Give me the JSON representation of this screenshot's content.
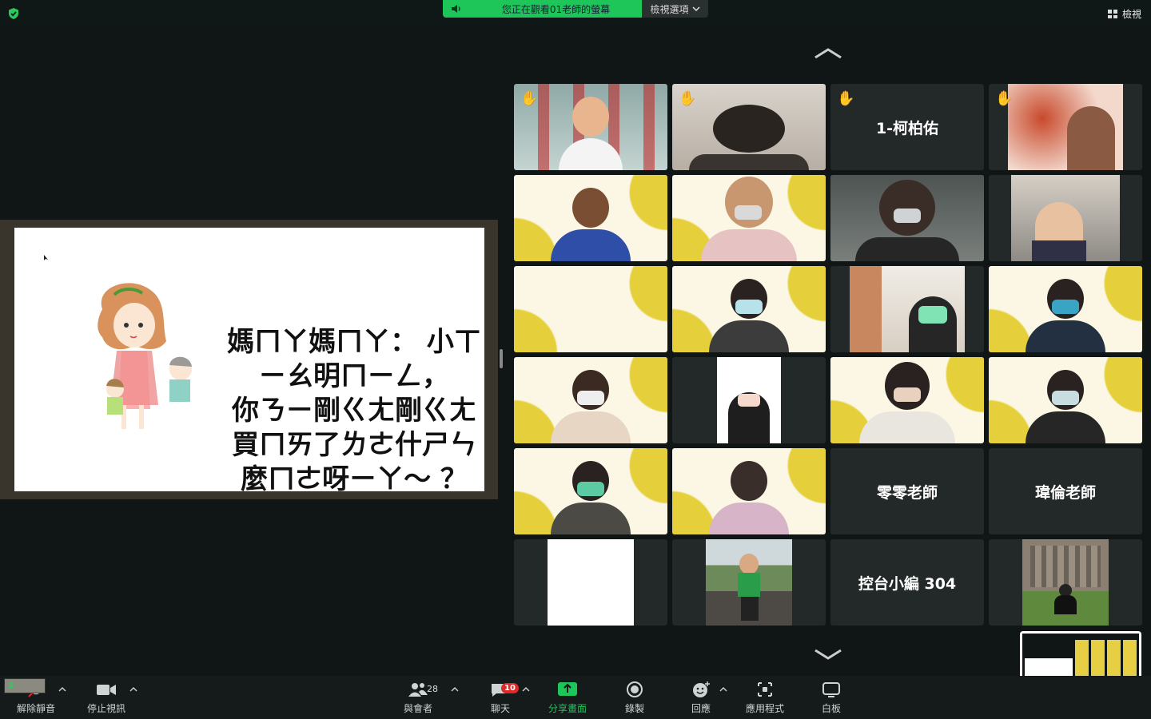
{
  "top": {
    "viewing_notice": "您正在觀看01老師的螢幕",
    "view_options": "檢視選項",
    "view_button": "檢視"
  },
  "slide": {
    "line1": "媽ㄇㄚ媽ㄇㄚ： 小ㄒㄧㄠ明ㄇㄧㄥ，",
    "line2": "你ㄋㄧ剛ㄍㄤ剛ㄍㄤ買ㄇㄞ了ㄌㄜ什ㄕㄣ",
    "line3": "麼ㄇㄜ呀ㄧㄚ～ ？"
  },
  "participants": [
    {
      "name": "",
      "hand": true
    },
    {
      "name": "",
      "hand": true
    },
    {
      "name": "1-柯柏佑",
      "hand": true
    },
    {
      "name": "",
      "hand": true
    },
    {
      "name": ""
    },
    {
      "name": ""
    },
    {
      "name": "",
      "active": true
    },
    {
      "name": ""
    },
    {
      "name": ""
    },
    {
      "name": ""
    },
    {
      "name": ""
    },
    {
      "name": ""
    },
    {
      "name": ""
    },
    {
      "name": ""
    },
    {
      "name": ""
    },
    {
      "name": ""
    },
    {
      "name": ""
    },
    {
      "name": ""
    },
    {
      "name": "零零老師"
    },
    {
      "name": "瑋倫老師"
    },
    {
      "name": ""
    },
    {
      "name": ""
    },
    {
      "name": "控台小編 304"
    },
    {
      "name": ""
    }
  ],
  "toolbar": {
    "unmute": "解除靜音",
    "stop_video": "停止視訊",
    "participants": "與會者",
    "participants_count": "28",
    "chat": "聊天",
    "chat_badge": "10",
    "share_screen": "分享畫面",
    "record": "錄製",
    "reactions": "回應",
    "apps": "應用程式",
    "whiteboard": "白板"
  },
  "status_badge": "$",
  "colors": {
    "accent_green": "#1ec559",
    "active_border": "#27c05a",
    "badge_red": "#e02828"
  }
}
